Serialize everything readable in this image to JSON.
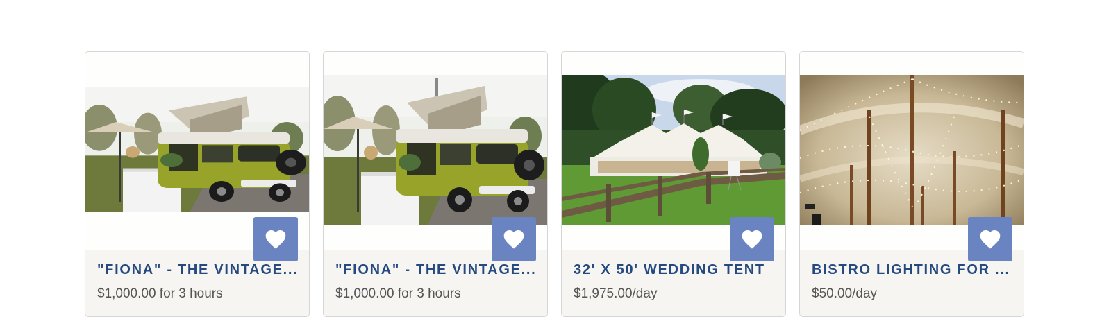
{
  "listings": [
    {
      "title": "\"FIONA\" - THE VINTAGE...",
      "price": "$1,000.00 for 3 hours",
      "favorite_icon": "heart-icon",
      "image": "vintage-camper-van-photo"
    },
    {
      "title": "\"FIONA\" - THE VINTAGE...",
      "price": "$1,000.00 for 3 hours",
      "favorite_icon": "heart-icon",
      "image": "vintage-camper-van-photo"
    },
    {
      "title": "32' X 50' WEDDING TENT",
      "price": "$1,975.00/day",
      "favorite_icon": "heart-icon",
      "image": "wedding-tent-photo"
    },
    {
      "title": "BISTRO LIGHTING FOR ...",
      "price": "$50.00/day",
      "favorite_icon": "heart-icon",
      "image": "bistro-lighting-photo"
    }
  ],
  "colors": {
    "title": "#264a80",
    "price": "#555555",
    "favorite_button": "#6a84c2",
    "card_footer": "#f6f5f2"
  }
}
